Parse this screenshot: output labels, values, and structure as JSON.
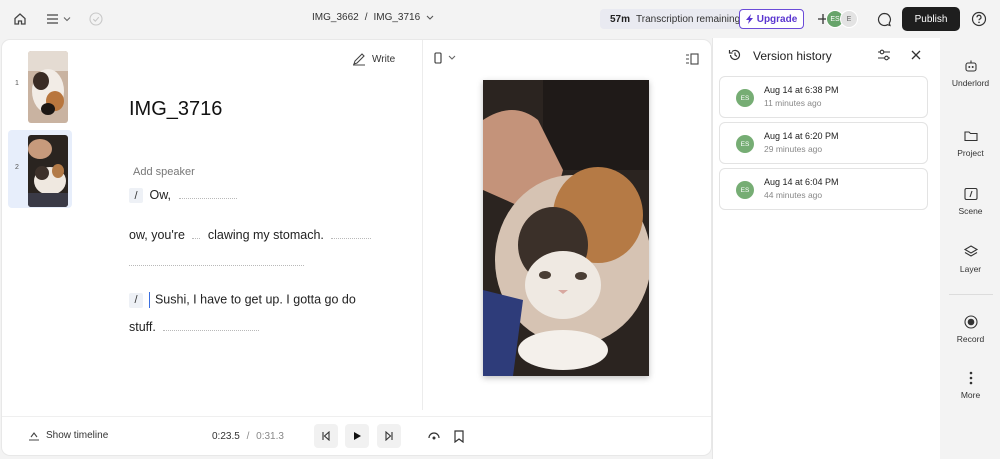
{
  "topbar": {
    "breadcrumb_parent": "IMG_3662",
    "breadcrumb_sep": "/",
    "breadcrumb_current": "IMG_3716",
    "transcription_minutes": "57m",
    "transcription_label": "Transcription remaining",
    "upgrade_label": "Upgrade",
    "avatar1": "ES",
    "avatar2": "E",
    "publish_label": "Publish"
  },
  "editor": {
    "thumbnails": [
      {
        "num": "1"
      },
      {
        "num": "2"
      }
    ],
    "doc_title": "IMG_3716",
    "write_label": "Write",
    "add_speaker": "Add speaker",
    "slash": "/",
    "line1": "Ow,",
    "line2a": "ow, you're",
    "line2b": "clawing my stomach.",
    "line3": "Sushi, I have to get up. I gotta go do",
    "line4": "stuff."
  },
  "bottom": {
    "show_timeline": "Show timeline",
    "current_time": "0:23.5",
    "time_sep": "/",
    "total_time": "0:31.3"
  },
  "version_panel": {
    "title": "Version history",
    "versions": [
      {
        "initials": "ES",
        "time": "Aug 14 at 6:38 PM",
        "ago": "11 minutes ago"
      },
      {
        "initials": "ES",
        "time": "Aug 14 at 6:20 PM",
        "ago": "29 minutes ago"
      },
      {
        "initials": "ES",
        "time": "Aug 14 at 6:04 PM",
        "ago": "44 minutes ago"
      }
    ]
  },
  "rail": {
    "items": [
      {
        "label": "Underlord",
        "icon": "robot-icon"
      },
      {
        "label": "Project",
        "icon": "folder-icon"
      },
      {
        "label": "Scene",
        "icon": "scene-icon"
      },
      {
        "label": "Layer",
        "icon": "layers-icon"
      },
      {
        "label": "Record",
        "icon": "record-icon"
      },
      {
        "label": "More",
        "icon": "more-icon"
      }
    ]
  },
  "colors": {
    "accent": "#5a35d0",
    "avatar": "#76ad74",
    "publish_bg": "#1e1e1e"
  }
}
